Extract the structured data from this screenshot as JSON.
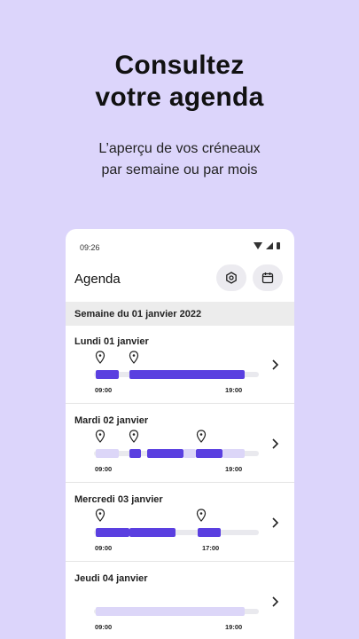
{
  "headline": {
    "line1": "Consultez",
    "line2": "votre agenda"
  },
  "subline": {
    "line1": "L’aperçu de vos créneaux",
    "line2": "par semaine ou par mois"
  },
  "status": {
    "time": "09:26"
  },
  "appbar": {
    "title": "Agenda",
    "settings_icon": "settings-icon",
    "calendar_icon": "calendar-icon"
  },
  "week": {
    "label": "Semaine du 01 janvier 2022"
  },
  "days": [
    {
      "label": "Lundi 01 janvier",
      "start": "09:00",
      "end": "19:00"
    },
    {
      "label": "Mardi 02 janvier",
      "start": "09:00",
      "end": "19:00"
    },
    {
      "label": "Mercredi 03 janvier",
      "start": "09:00",
      "end": "17:00"
    },
    {
      "label": "Jeudi 04 janvier",
      "start": "09:00",
      "end": "19:00"
    }
  ],
  "colors": {
    "accent": "#5a3fe0",
    "accent_light": "#dcd6f8",
    "background": "#dcd5fb"
  }
}
